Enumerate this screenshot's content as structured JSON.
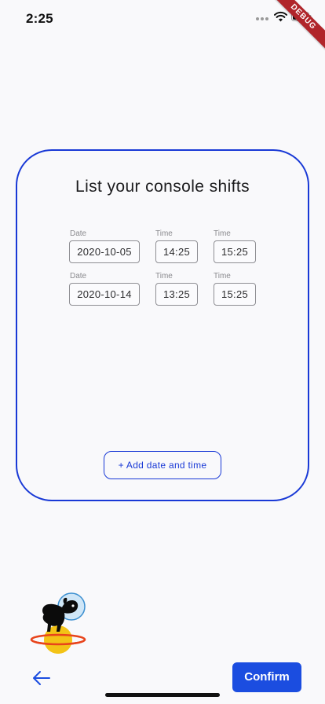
{
  "status_bar": {
    "time": "2:25"
  },
  "debug_banner": "DEBUG",
  "card": {
    "title": "List your console shifts",
    "border_color": "#1939d6",
    "date_label": "Date",
    "time_label": "Time",
    "shifts": [
      {
        "date": "2020-10-05",
        "start": "14:25",
        "end": "15:25"
      },
      {
        "date": "2020-10-14",
        "start": "13:25",
        "end": "15:25"
      }
    ],
    "add_button_label": "+ Add date and time"
  },
  "footer": {
    "back_icon": "arrow-left-icon",
    "confirm_label": "Confirm",
    "confirm_color": "#1b4de0"
  },
  "mascot_icon": "astronaut-dog-on-planet"
}
